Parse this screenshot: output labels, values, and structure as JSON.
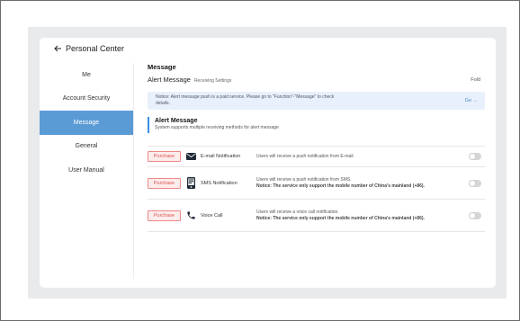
{
  "header": {
    "back_label": "Personal Center"
  },
  "sidebar": {
    "items": [
      {
        "label": "Me",
        "active": false
      },
      {
        "label": "Account Security",
        "active": false
      },
      {
        "label": "Message",
        "active": true
      },
      {
        "label": "General",
        "active": false
      },
      {
        "label": "User Manual",
        "active": false
      }
    ]
  },
  "main": {
    "title": "Message",
    "subhead": {
      "name": "Alert Message",
      "small": "Receiving Settings",
      "fold": "Fold"
    },
    "notice": {
      "line1": "Notice: Alert message push is a paid service. Please go to \"Function\"-\"Message\" to check",
      "line2": "details.",
      "go": "Go →"
    },
    "section": {
      "heading": "Alert Message",
      "desc": "System supports multiple receiving methods for alert message"
    },
    "rows": [
      {
        "tag": "Purchase",
        "icon": "envelope-icon",
        "label": "E-mail Notification",
        "desc1": "Users will receive a push notification from E-mail.",
        "desc2": "",
        "enabled": false
      },
      {
        "tag": "Purchase",
        "icon": "phone-device-icon",
        "label": "SMS Notification",
        "desc1": "Users will receive a push notification from SMS.",
        "desc2": "Notice: The service only support the mobile number of China's mainland (+86).",
        "enabled": false
      },
      {
        "tag": "Purchase",
        "icon": "phone-handset-icon",
        "label": "Voice Call",
        "desc1": "Users will receive a voice call notification.",
        "desc2": "Notice: The service only support the mobile number of China's mainland (+86).",
        "enabled": false
      }
    ]
  },
  "colors": {
    "accent": "#5b9bd5",
    "tag_text": "#d9534f",
    "tag_bg": "#fdecec",
    "notice_bg": "#e8f0fb"
  }
}
